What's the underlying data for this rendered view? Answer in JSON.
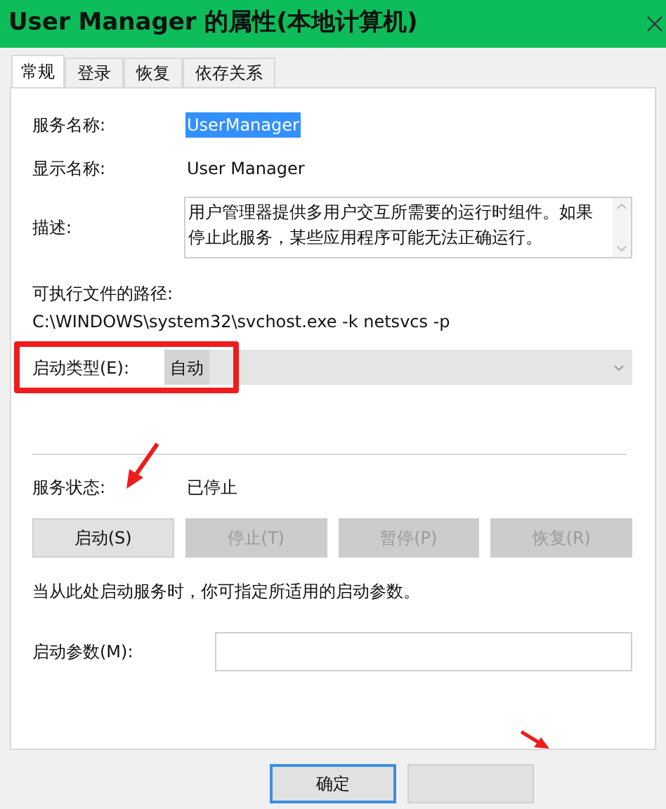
{
  "window": {
    "title": "User Manager 的属性(本地计算机)"
  },
  "tabs": [
    {
      "label": "常规",
      "selected": true
    },
    {
      "label": "登录",
      "selected": false
    },
    {
      "label": "恢复",
      "selected": false
    },
    {
      "label": "依存关系",
      "selected": false
    }
  ],
  "service_name": {
    "label": "服务名称:",
    "value": "UserManager",
    "selected": true
  },
  "display_name": {
    "label": "显示名称:",
    "value": "User Manager"
  },
  "description": {
    "label": "描述:",
    "value": "用户管理器提供多用户交互所需要的运行时组件。如果停止此服务，某些应用程序可能无法正确运行。"
  },
  "executable_path": {
    "label": "可执行文件的路径:",
    "value": "C:\\WINDOWS\\system32\\svchost.exe -k netsvcs -p"
  },
  "startup_type": {
    "label": "启动类型(E):",
    "value": "自动"
  },
  "service_status": {
    "label": "服务状态:",
    "value": "已停止"
  },
  "service_buttons": [
    {
      "label": "启动(S)",
      "disabled": false
    },
    {
      "label": "停止(T)",
      "disabled": true
    },
    {
      "label": "暂停(P)",
      "disabled": true
    },
    {
      "label": "恢复(R)",
      "disabled": true
    }
  ],
  "hint": "当从此处启动服务时，你可指定所适用的启动参数。",
  "start_parameters": {
    "label": "启动参数(M):"
  },
  "footer_buttons": [
    {
      "label": "确定"
    }
  ]
}
